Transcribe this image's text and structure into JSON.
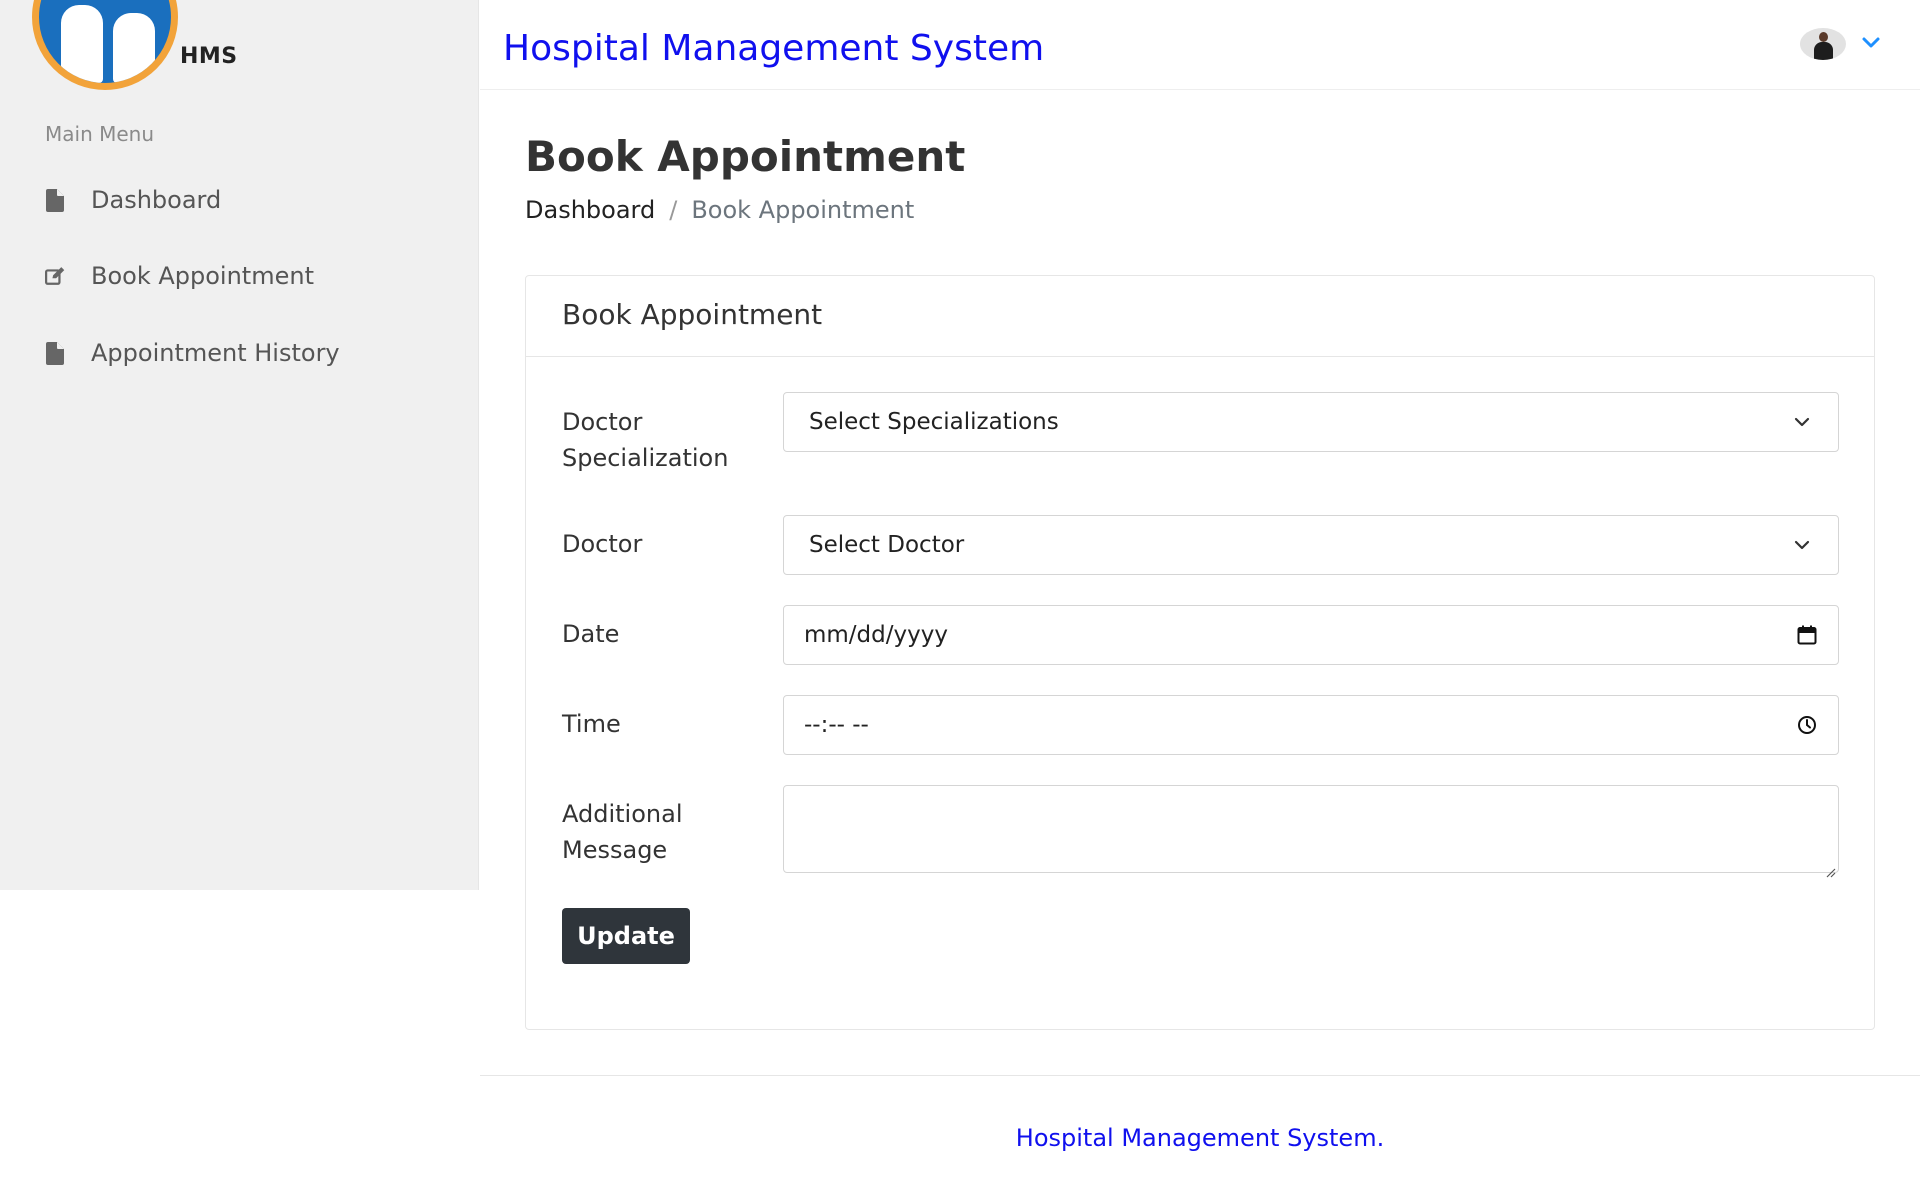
{
  "app": {
    "logo_text": "HMS",
    "title": "Hospital Management System"
  },
  "sidebar": {
    "heading": "Main Menu",
    "items": [
      {
        "label": "Dashboard",
        "icon": "file-icon"
      },
      {
        "label": "Book Appointment",
        "icon": "edit-icon"
      },
      {
        "label": "Appointment History",
        "icon": "file-icon"
      }
    ]
  },
  "header": {
    "avatar": "user-avatar",
    "menu_icon": "chevron-down-icon"
  },
  "page": {
    "title": "Book Appointment",
    "breadcrumb": {
      "link": "Dashboard",
      "separator": "/",
      "current": "Book Appointment"
    }
  },
  "form": {
    "card_title": "Book Appointment",
    "specialization": {
      "label_line1": "Doctor",
      "label_line2": "Specialization",
      "selected": "Select Specializations"
    },
    "doctor": {
      "label": "Doctor",
      "selected": "Select Doctor"
    },
    "date": {
      "label": "Date",
      "placeholder": "mm/dd/yyyy"
    },
    "time": {
      "label": "Time",
      "placeholder": "--:-- --"
    },
    "message": {
      "label_line1": "Additional",
      "label_line2": "Message",
      "value": ""
    },
    "submit_label": "Update"
  },
  "footer": {
    "text": "Hospital Management System."
  },
  "colors": {
    "accent_blue": "#1010ee",
    "logo_blue": "#1a6fbe",
    "logo_ring": "#f2a33a",
    "button_dark": "#2f353b",
    "sidebar_bg": "#f0f0f0"
  }
}
